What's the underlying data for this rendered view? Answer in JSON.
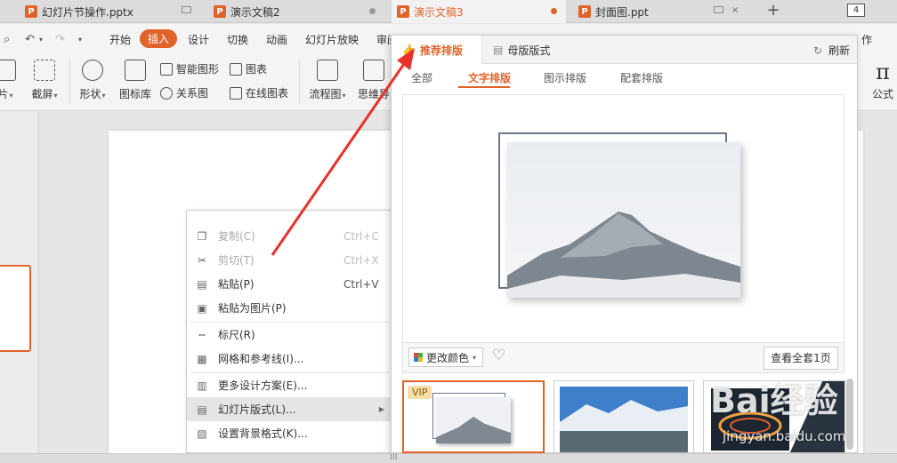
{
  "tabs": [
    {
      "label": "幻灯片节操作.pptx",
      "indicator": "monitor"
    },
    {
      "label": "演示文稿2",
      "indicator": "dot"
    },
    {
      "label": "演示文稿3",
      "indicator": "dot"
    },
    {
      "label": "封面图.ppt",
      "indicator": "monitor"
    }
  ],
  "tab_count": "4",
  "menu": [
    "开始",
    "插入",
    "设计",
    "切换",
    "动画",
    "幻灯片放映",
    "审阅"
  ],
  "menu_right_fragment": "作",
  "ribbon": {
    "left_frag1": "片",
    "left_frag2": "截屏",
    "shape": "形状",
    "icon_lib": "图标库",
    "smart_graphic": "智能图形",
    "relation": "关系图",
    "chart": "图表",
    "online_chart": "在线图表",
    "flowchart": "流程图",
    "mindmap": "思维导",
    "formula": "公式"
  },
  "context_menu": [
    {
      "label": "复制(C)",
      "shortcut": "Ctrl+C",
      "icon": "copy-icon",
      "disabled": true
    },
    {
      "label": "剪切(T)",
      "shortcut": "Ctrl+X",
      "icon": "scissors-icon",
      "disabled": true
    },
    {
      "label": "粘贴(P)",
      "shortcut": "Ctrl+V",
      "icon": "paste-icon",
      "disabled": false
    },
    {
      "label": "粘贴为图片(P)",
      "shortcut": "",
      "icon": "paste-image-icon",
      "disabled": false
    },
    {
      "label": "标尺(R)",
      "shortcut": "",
      "icon": "ruler-icon",
      "disabled": false
    },
    {
      "label": "网格和参考线(I)...",
      "shortcut": "",
      "icon": "grid-icon",
      "disabled": false
    },
    {
      "label": "更多设计方案(E)...",
      "shortcut": "",
      "icon": "design-icon",
      "disabled": false
    },
    {
      "label": "幻灯片版式(L)...",
      "shortcut": "",
      "icon": "layout-icon",
      "disabled": false
    },
    {
      "label": "设置背景格式(K)...",
      "shortcut": "",
      "icon": "background-icon",
      "disabled": false
    }
  ],
  "panel": {
    "tab_recommend": "推荐排版",
    "tab_master": "母版版式",
    "refresh": "刷新",
    "subtabs": [
      "全部",
      "文字排版",
      "图示排版",
      "配套排版"
    ],
    "change_color": "更改颜色",
    "view_all": "查看全套1页",
    "vip": "VIP"
  },
  "watermark": "Bai经验",
  "watermark_sub": "jingyan.baidu.com",
  "colors": {
    "accent": "#e0632a",
    "arrow": "#e8312a"
  }
}
